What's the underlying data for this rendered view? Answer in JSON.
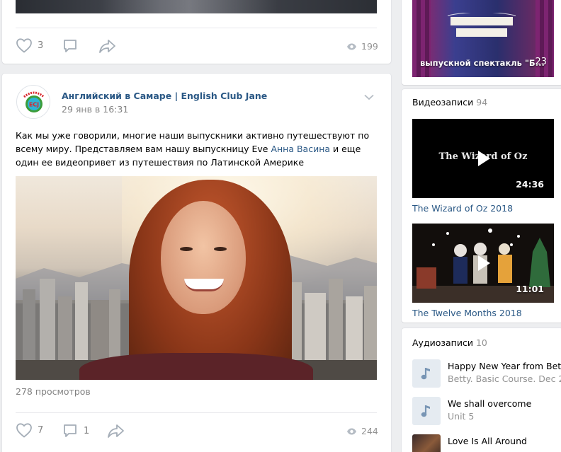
{
  "post1": {
    "likes": "3",
    "views": "199"
  },
  "post2": {
    "author": "Английский в Самаре | English Club Jane",
    "date": "29 янв в 16:31",
    "text_before_link": "Как мы уже говорили, многие наши выпускники активно путешествуют по всему миру. Представляем вам нашу выпускницу Eve ",
    "link_text": "Анна Васина",
    "text_after_link": " и еще один ее видеопривет из путешествия по Латинской Америке",
    "views_text": "278 просмотров",
    "likes": "7",
    "comments": "1",
    "views": "244",
    "avatar_text": "ECJ"
  },
  "photos": {
    "caption": "выпускной спектакль \"Б...",
    "count": "23"
  },
  "videos": {
    "header": "Видеозаписи",
    "count": "94",
    "items": [
      {
        "title": "The Wizard of Oz 2018",
        "overlay": "The Wizard of Oz",
        "duration": "24:36"
      },
      {
        "title": "The Twelve Months 2018",
        "duration": "11:01"
      }
    ]
  },
  "audio": {
    "header": "Аудиозаписи",
    "count": "10",
    "items": [
      {
        "title": "Happy New Year from Betty",
        "artist": "Betty. Basic Course. Dec 2"
      },
      {
        "title": "We shall overcome",
        "artist": "Unit 5"
      },
      {
        "title": "Love Is All Around",
        "artist": ""
      }
    ]
  },
  "colors": {
    "link": "#2a5885",
    "page_bg": "#edeef0",
    "muted": "#828282"
  },
  "icons": [
    "heart-icon",
    "comment-icon",
    "share-icon",
    "eye-icon",
    "chevron-down-icon",
    "play-icon",
    "music-note-icon"
  ]
}
